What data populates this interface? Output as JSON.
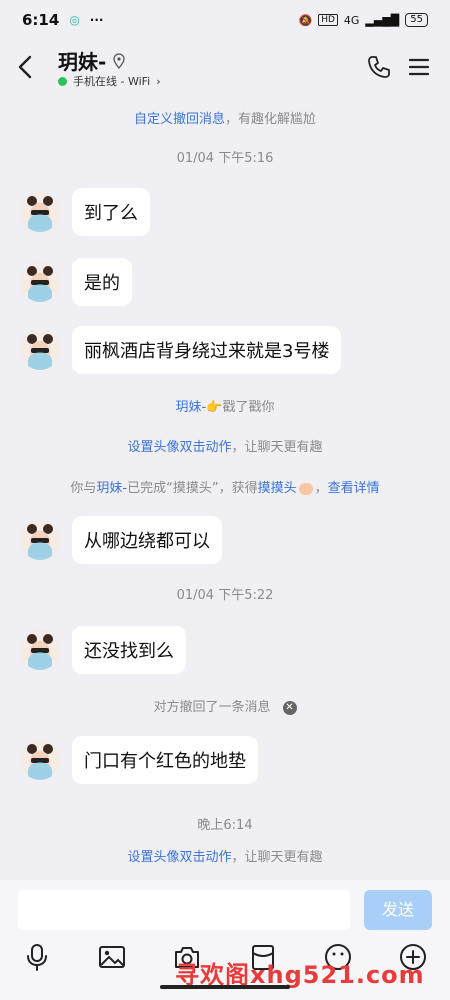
{
  "status_bar": {
    "time": "6:14",
    "network": "4G",
    "battery": "55"
  },
  "header": {
    "title": "玥妹-",
    "online_status": "手机在线 - WiFi",
    "chevron": "›"
  },
  "messages": [
    {
      "type": "system",
      "text_link": "自定义撤回消息",
      "text_rest": "，有趣化解尴尬"
    },
    {
      "type": "time",
      "text": "01/04 下午5:16"
    },
    {
      "type": "incoming",
      "text": "到了么"
    },
    {
      "type": "incoming",
      "text": "是的"
    },
    {
      "type": "incoming",
      "text": "丽枫酒店背身绕过来就是3号楼"
    },
    {
      "type": "system",
      "text_link": "玥妹-",
      "text_rest": "戳了戳你",
      "emoji": "👉"
    },
    {
      "type": "system",
      "text_link": "设置头像双击动作",
      "text_rest": "，让聊天更有趣"
    },
    {
      "type": "system",
      "prefix": "你与",
      "name_link": "玥妹-",
      "mid": "已完成“摸摸头”，获得",
      "badge_link": "摸摸头",
      "suffix": "，",
      "detail_link": "查看详情"
    },
    {
      "type": "incoming",
      "text": "从哪边绕都可以"
    },
    {
      "type": "time",
      "text": "01/04 下午5:22"
    },
    {
      "type": "incoming",
      "text": "还没找到么"
    },
    {
      "type": "system",
      "text": "对方撤回了一条消息"
    },
    {
      "type": "incoming",
      "text": "门口有个红色的地垫"
    },
    {
      "type": "time",
      "text": "晚上6:14"
    },
    {
      "type": "system",
      "text_link": "设置头像双击动作",
      "text_rest": "，让聊天更有趣"
    }
  ],
  "input": {
    "placeholder": "",
    "send_label": "发送"
  },
  "toolbar": [
    "microphone-icon",
    "image-icon",
    "camera-icon",
    "red-packet-icon",
    "emoji-icon",
    "plus-icon"
  ],
  "watermark": "寻欢阁xhg521.com",
  "colors": {
    "link": "#3a74d8",
    "send_button": "#a7cff8",
    "online_dot": "#2bc25a",
    "background": "#f0f0f4"
  }
}
